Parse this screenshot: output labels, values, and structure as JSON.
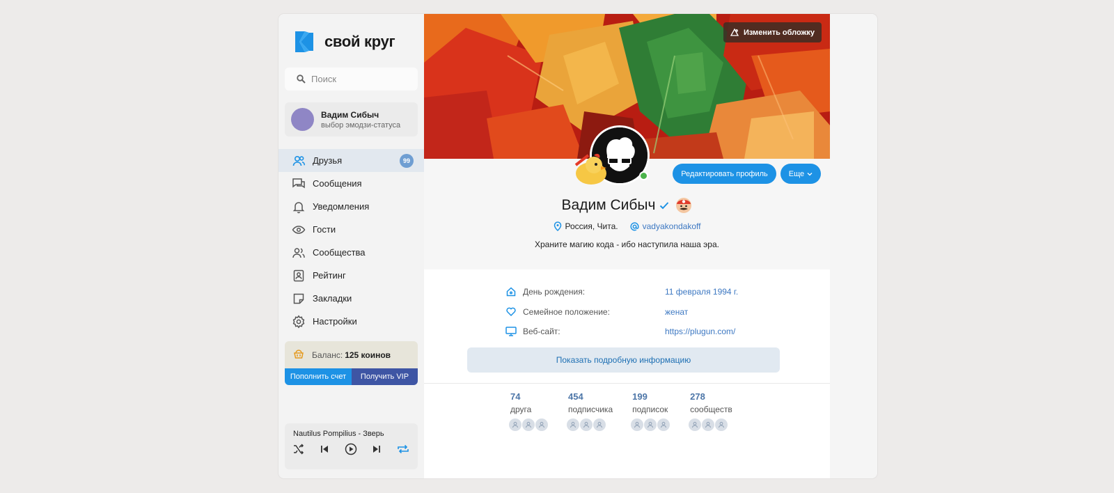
{
  "brand": {
    "name": "свой круг",
    "accent": "#1d92e5"
  },
  "search": {
    "placeholder": "Поиск"
  },
  "user": {
    "name": "Вадим Сибыч",
    "status": "выбор эмодзи-статуса"
  },
  "nav": [
    {
      "label": "Друзья",
      "icon": "friends-icon",
      "badge": "99",
      "active": true
    },
    {
      "label": "Сообщения",
      "icon": "messages-icon"
    },
    {
      "label": "Уведомления",
      "icon": "bell-icon"
    },
    {
      "label": "Гости",
      "icon": "eye-icon"
    },
    {
      "label": "Сообщества",
      "icon": "communities-icon"
    },
    {
      "label": "Рейтинг",
      "icon": "rating-icon"
    },
    {
      "label": "Закладки",
      "icon": "bookmark-icon"
    },
    {
      "label": "Настройки",
      "icon": "gear-icon"
    }
  ],
  "balance": {
    "label": "Баланс:",
    "value": "125 коинов",
    "topup": "Пополнить счет",
    "vip": "Получить VIP"
  },
  "player": {
    "track": "Nautilus Pompilius - Зверь"
  },
  "cover": {
    "change_label": "Изменить обложку"
  },
  "profile": {
    "edit_label": "Редактировать профиль",
    "more_label": "Еще",
    "name": "Вадим Сибыч",
    "location": "Россия, Чита.",
    "handle": "vadyakondakoff",
    "bio": "Храните магию кода - ибо наступила наша эра."
  },
  "info": [
    {
      "label": "День рождения:",
      "value": "11 февраля 1994 г.",
      "icon": "home-icon"
    },
    {
      "label": "Семейное положение:",
      "value": "женат",
      "icon": "heart-icon"
    },
    {
      "label": "Веб-сайт:",
      "value": "https://plugun.com/",
      "icon": "monitor-icon"
    }
  ],
  "show_more": "Показать подробную информацию",
  "stats": [
    {
      "num": "74",
      "label": "друга"
    },
    {
      "num": "454",
      "label": "подписчика"
    },
    {
      "num": "199",
      "label": "подписок"
    },
    {
      "num": "278",
      "label": "сообществ"
    }
  ]
}
